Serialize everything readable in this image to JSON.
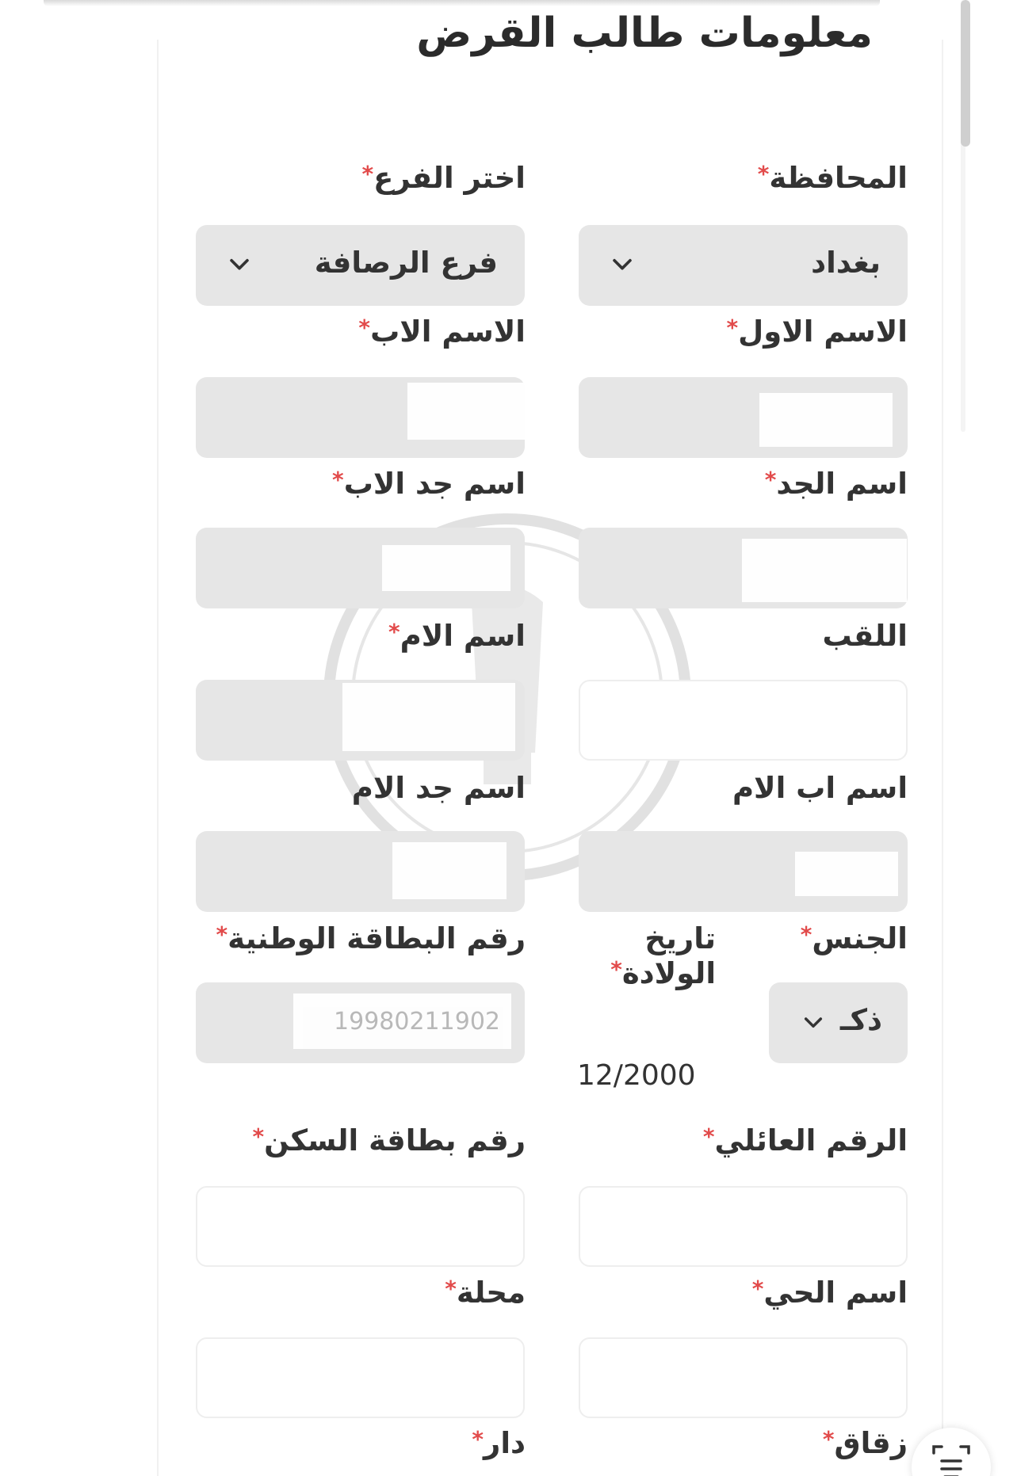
{
  "form": {
    "title": "معلومات طالب القرض",
    "required_mark": "*",
    "province": {
      "label": "المحافظة",
      "value": "بغداد"
    },
    "branch": {
      "label": "اختر الفرع",
      "value": "فرع الرصافة"
    },
    "first_name": {
      "label": "الاسم الاول",
      "value": ""
    },
    "father_name": {
      "label": "الاسم الاب",
      "value": ""
    },
    "grandfather_name": {
      "label": "اسم الجد",
      "value": ""
    },
    "father_grandfather_name": {
      "label": "اسم جد الاب",
      "value": ""
    },
    "surname": {
      "label": "اللقب",
      "value": ""
    },
    "mother_name": {
      "label": "اسم الام",
      "value": ""
    },
    "mother_father_name": {
      "label": "اسم اب الام",
      "value": ""
    },
    "mother_grandfather_name": {
      "label": "اسم جد الام",
      "value": ""
    },
    "gender": {
      "label": "الجنس",
      "value": "ذكـ"
    },
    "birth_date": {
      "label_line1": "تاريخ",
      "label_line2": "الولادة",
      "value": "12/2000"
    },
    "national_id": {
      "label": "رقم البطاقة الوطنية",
      "value": "19980211902"
    },
    "family_number": {
      "label": "الرقم العائلي",
      "value": ""
    },
    "residence_card": {
      "label": "رقم بطاقة السكن",
      "value": ""
    },
    "district_name": {
      "label": "اسم الحي",
      "value": ""
    },
    "mahalla": {
      "label": "محلة",
      "value": ""
    },
    "alley": {
      "label": "زقاق",
      "value": ""
    },
    "house": {
      "label": "دار",
      "value": ""
    }
  },
  "icons": {
    "dropdown": "chevron-down-icon",
    "fab": "text-scan-icon"
  },
  "colors": {
    "filled_field_bg": "#e6e6e6",
    "required_mark": "#e24b4b",
    "text": "#333333"
  }
}
